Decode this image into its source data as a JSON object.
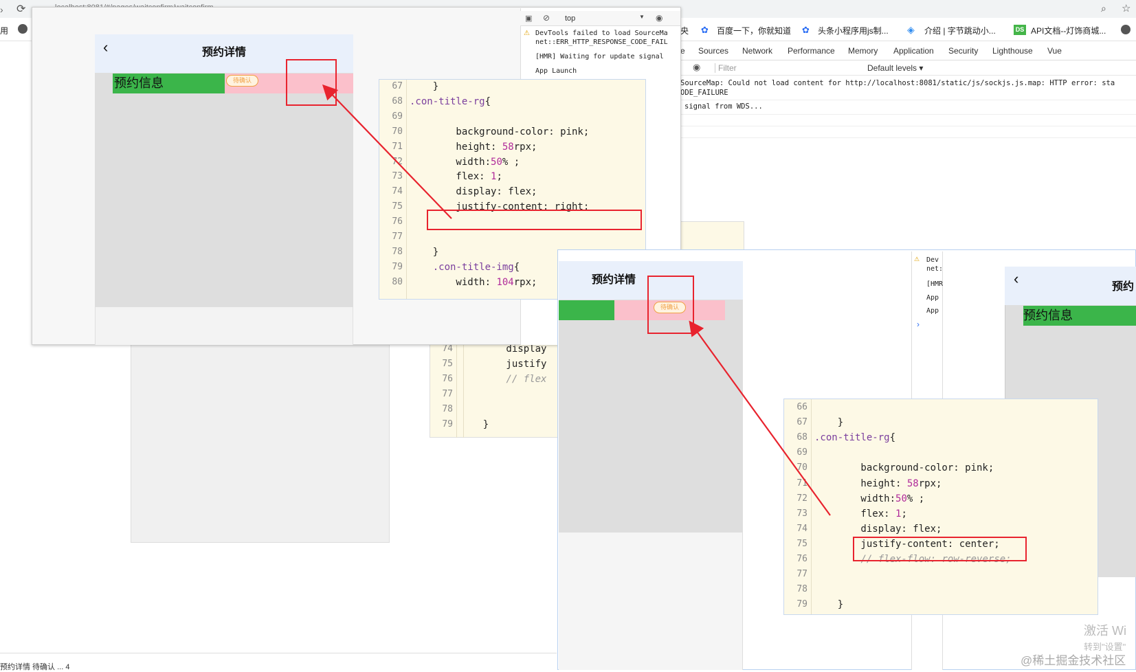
{
  "browser": {
    "url": "localhost:8081/#/pages/waitconfirm/waitconfirm",
    "bookmarks": [
      "百度一下，你就知道",
      "头条小程序用js制...",
      "介绍 | 字节跳动小...",
      "API文档--灯饰商城..."
    ],
    "bookmark_badge": "DS",
    "left_edge_text": "用"
  },
  "devtools": {
    "tabs": [
      "Sources",
      "Network",
      "Performance",
      "Memory",
      "Application",
      "Security",
      "Lighthouse",
      "Vue"
    ],
    "context": "top",
    "filter_placeholder": "Filter",
    "levels": "Default levels ▾",
    "console_lines": [
      "SourceMap: Could not load content for http://localhost:8081/static/js/sockjs.js.map: HTTP error: sta",
      "ODE_FAILURE",
      "signal from WDS..."
    ],
    "inner_console": [
      "DevTools failed to load SourceMa",
      "net::ERR_HTTP_RESPONSE_CODE_FAIL",
      "[HMR] Waiting for update signal",
      "App Launch"
    ],
    "small_console": [
      "Dev",
      "net:",
      "[HMR",
      "App",
      "App"
    ],
    "tab_prefix": "e",
    "left_clip": "央"
  },
  "app": {
    "nav_title": "预约详情",
    "section_title": "预约信息",
    "badge": "待确认",
    "nav_title_clipped": "预约"
  },
  "code_top": {
    "lines": [
      {
        "n": "67",
        "t": "    }"
      },
      {
        "n": "68",
        "t": ".con-title-rg{"
      },
      {
        "n": "69",
        "t": ""
      },
      {
        "n": "70",
        "t": "        background-color: pink;"
      },
      {
        "n": "71",
        "t": "        height: 58rpx;"
      },
      {
        "n": "72",
        "t": "        width:50% ;"
      },
      {
        "n": "73",
        "t": "        flex: 1;"
      },
      {
        "n": "74",
        "t": "        display: flex;"
      },
      {
        "n": "75",
        "t": "        justify-content: right;"
      },
      {
        "n": "76",
        "t": ""
      },
      {
        "n": "77",
        "t": ""
      },
      {
        "n": "78",
        "t": "    }"
      },
      {
        "n": "79",
        "t": "    .con-title-img{"
      },
      {
        "n": "80",
        "t": "        width: 104rpx;"
      }
    ]
  },
  "code_mid": {
    "lines": [
      {
        "n": "74",
        "t": "        display"
      },
      {
        "n": "75",
        "t": "        justify"
      },
      {
        "n": "76",
        "t": "        // flex"
      },
      {
        "n": "77",
        "t": ""
      },
      {
        "n": "78",
        "t": ""
      },
      {
        "n": "79",
        "t": "    }"
      }
    ]
  },
  "code_bottom": {
    "lines": [
      {
        "n": "66",
        "t": ""
      },
      {
        "n": "67",
        "t": "    }"
      },
      {
        "n": "68",
        "t": ".con-title-rg{"
      },
      {
        "n": "69",
        "t": ""
      },
      {
        "n": "70",
        "t": "        background-color: pink;"
      },
      {
        "n": "71",
        "t": "        height: 58rpx;"
      },
      {
        "n": "72",
        "t": "        width:50% ;"
      },
      {
        "n": "73",
        "t": "        flex: 1;"
      },
      {
        "n": "74",
        "t": "        display: flex;"
      },
      {
        "n": "75",
        "t": "        justify-content: center;"
      },
      {
        "n": "76",
        "t": "        // flex-flow: row-reverse;"
      },
      {
        "n": "77",
        "t": ""
      },
      {
        "n": "78",
        "t": ""
      },
      {
        "n": "79",
        "t": "    }"
      }
    ]
  },
  "status": {
    "bottom_text": "预约详情 待确认  ...  4"
  },
  "watermark": {
    "activate": "激活 Wi",
    "activate_sub": "转到\"设置\"",
    "credit": "@稀土掘金技术社区"
  },
  "colors": {
    "annotation_red": "#e8232e",
    "green": "#3bb54a",
    "pink": "#fbc0cb"
  }
}
